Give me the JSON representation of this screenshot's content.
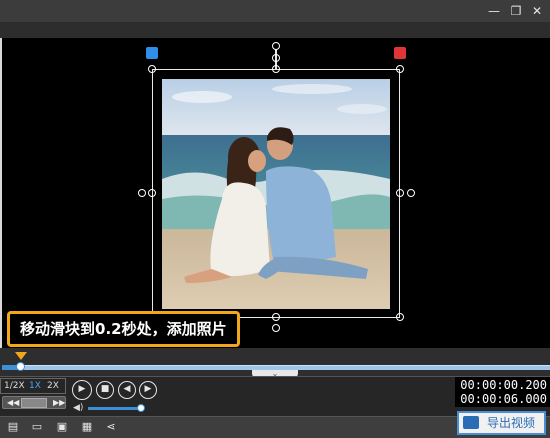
{
  "window": {
    "minimize_icon": "—",
    "restore_icon": "❐",
    "close_icon": "✕"
  },
  "tooltip": {
    "text": "移动滑块到0.2秒处，添加照片"
  },
  "speed": {
    "options": [
      "1/2X",
      "1X",
      "2X"
    ],
    "selected": "1X"
  },
  "timeline": {
    "progress": 0.033
  },
  "volume": {
    "level": 0.95
  },
  "timecode": {
    "current": "00:00:00.200",
    "total": "00:00:06.000"
  },
  "export": {
    "label": "导出视频"
  },
  "colors": {
    "accent": "#3d8fd8",
    "tooltip_border": "#f2a71a",
    "delete": "#e03535",
    "layer": "#2e8ee8"
  }
}
